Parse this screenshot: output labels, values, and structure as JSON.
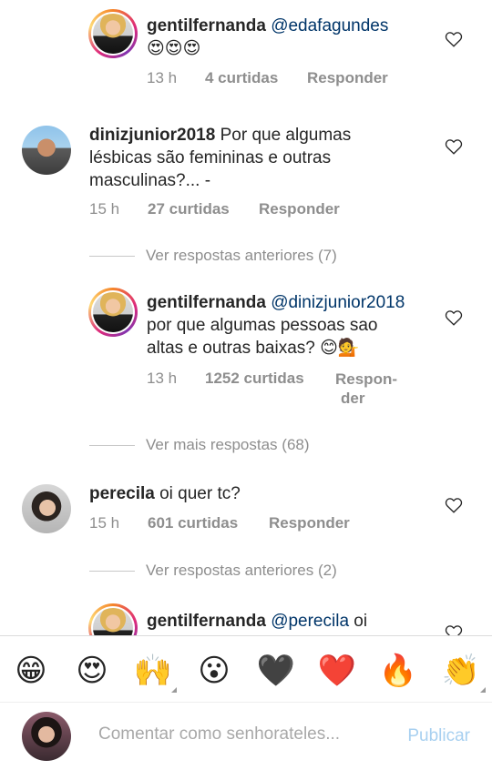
{
  "comments": [
    {
      "username": "gentilfernanda",
      "mention": "@edafagundes",
      "line2": "😍😍😍",
      "time": "13 h",
      "likes": "4 curtidas",
      "reply": "Responder"
    },
    {
      "username": "dinizjunior2018",
      "text1": "Por que algumas",
      "text2": "lésbicas são femininas e outras",
      "text3": "masculinas?... -",
      "time": "15 h",
      "likes": "27 curtidas",
      "reply": "Responder"
    },
    {
      "username": "gentilfernanda",
      "mention": "@dinizjunior2018",
      "text2": "por que algumas pessoas sao",
      "text3": "altas e outras baixas? 😊💁",
      "time": "13 h",
      "likes": "1252 curtidas",
      "reply1": "Respon-",
      "reply2": "der"
    },
    {
      "username": "perecila",
      "text1": "oi quer tc?",
      "time": "15 h",
      "likes": "601 curtidas",
      "reply": "Responder"
    },
    {
      "username": "gentilfernanda",
      "mention": "@perecila",
      "text1": "oi"
    }
  ],
  "view_more": [
    "Ver respostas anteriores (7)",
    "Ver mais respostas (68)",
    "Ver respostas anteriores (2)"
  ],
  "emoji_bar": [
    {
      "char": "😁",
      "icon": "grinning-face-icon"
    },
    {
      "char": "😍",
      "icon": "heart-eyes-icon"
    },
    {
      "char": "🙌",
      "icon": "raising-hands-icon"
    },
    {
      "char": "😮",
      "icon": "surprised-face-icon"
    },
    {
      "char": "🖤",
      "icon": "black-heart-icon"
    },
    {
      "char": "❤️",
      "icon": "red-heart-icon"
    },
    {
      "char": "🔥",
      "icon": "fire-icon"
    },
    {
      "char": "👏",
      "icon": "clapping-hands-icon"
    }
  ],
  "composer": {
    "placeholder": "Comentar como senhorateles...",
    "post_label": "Publicar"
  },
  "colors": {
    "mention": "#003569",
    "meta": "#8e8e8e",
    "post_disabled": "#a8d0f0"
  }
}
